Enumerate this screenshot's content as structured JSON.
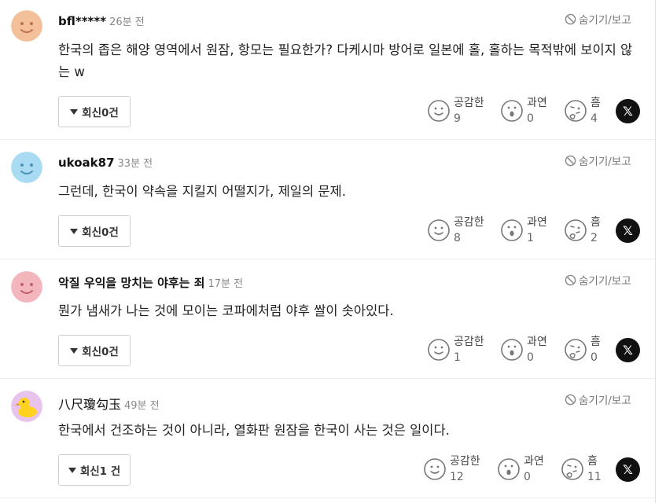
{
  "comments": [
    {
      "nickname": "bfl*****",
      "time": "26분 전",
      "hide_label": "숨기기/보고",
      "text": "한국의 좁은 해양 영역에서 원잠, 항모는 필요한가? 다케시마 방어로 일본에 홀, 홀하는 목적밖에 보이지 않는 w",
      "reply_label": "회신0건",
      "reactions": [
        {
          "label": "공감한",
          "count": "9"
        },
        {
          "label": "과연",
          "count": "0"
        },
        {
          "label": "흠",
          "count": "4"
        }
      ],
      "avatar_color": "#f3c09a"
    },
    {
      "nickname": "ukoak87",
      "time": "33분 전",
      "hide_label": "숨기기/보고",
      "text": "그런데, 한국이 약속을 지킬지 어떨지가, 제일의 문제.",
      "reply_label": "회신0건",
      "reactions": [
        {
          "label": "공감한",
          "count": "8"
        },
        {
          "label": "과연",
          "count": "1"
        },
        {
          "label": "흠",
          "count": "2"
        }
      ],
      "avatar_color": "#a9dcf2"
    },
    {
      "nickname": "악질 우익을 망치는 야후는 죄",
      "time": "17분 전",
      "hide_label": "숨기기/보고",
      "text": "뭔가 냄새가 나는 것에 모이는 코파에처럼 야후 쌀이 솟아있다.",
      "reply_label": "회신0건",
      "reactions": [
        {
          "label": "공감한",
          "count": "1"
        },
        {
          "label": "과연",
          "count": "0"
        },
        {
          "label": "흠",
          "count": "0"
        }
      ],
      "avatar_color": "#f3b6bd"
    },
    {
      "nickname": "八尺瓊勾玉",
      "time": "49분 전",
      "hide_label": "숨기기/보고",
      "text": "한국에서 건조하는 것이 아니라, 열화판 원잠을 한국이 사는 것은 일이다.",
      "reply_label": "회신1 건",
      "reactions": [
        {
          "label": "공감한",
          "count": "12"
        },
        {
          "label": "과연",
          "count": "0"
        },
        {
          "label": "흠",
          "count": "11"
        }
      ],
      "avatar_color": "#e8c3ee"
    }
  ],
  "share_icon": "x-logo-icon",
  "share_glyph": "𝕏"
}
